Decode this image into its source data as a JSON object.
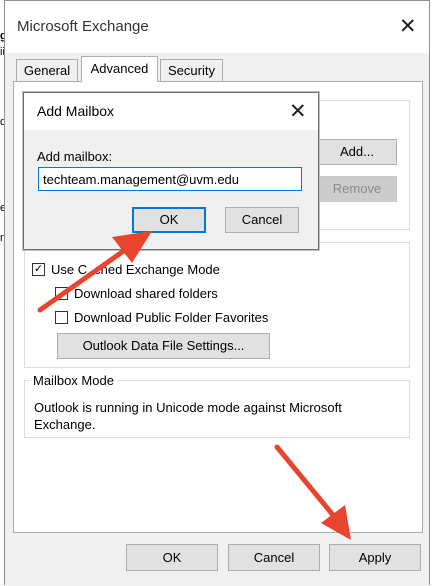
{
  "window": {
    "title": "Microsoft Exchange",
    "close_glyph": "✕"
  },
  "tabs": [
    {
      "label": "General",
      "active": false
    },
    {
      "label": "Advanced",
      "active": true
    },
    {
      "label": "Security",
      "active": false
    }
  ],
  "mailboxes": {
    "add_label": "Add...",
    "remove_label": "Remove"
  },
  "cached_mode": {
    "checkbox_label_a": "Use C",
    "checkbox_label_b": "ched Exchange Mode",
    "checked": true,
    "download_shared": {
      "label": "Download shared folders",
      "checked": false
    },
    "download_public": {
      "label": "Download Public Folder Favorites",
      "checked": false
    },
    "data_file_button": "Outlook Data File Settings..."
  },
  "mailbox_mode": {
    "title": "Mailbox Mode",
    "text": "Outlook is running in Unicode mode against Microsoft Exchange."
  },
  "bottom_buttons": {
    "ok": "OK",
    "cancel": "Cancel",
    "apply": "Apply"
  },
  "dialog": {
    "title": "Add Mailbox",
    "close_glyph": "✕",
    "label": "Add mailbox:",
    "input_value": "techteam.management@uvm.edu",
    "ok": "OK",
    "cancel": "Cancel"
  },
  "background_fragments": [
    "g",
    "ii",
    "d",
    "e",
    "n"
  ],
  "colors": {
    "accent": "#0078d7",
    "arrow": "#e8442e"
  }
}
